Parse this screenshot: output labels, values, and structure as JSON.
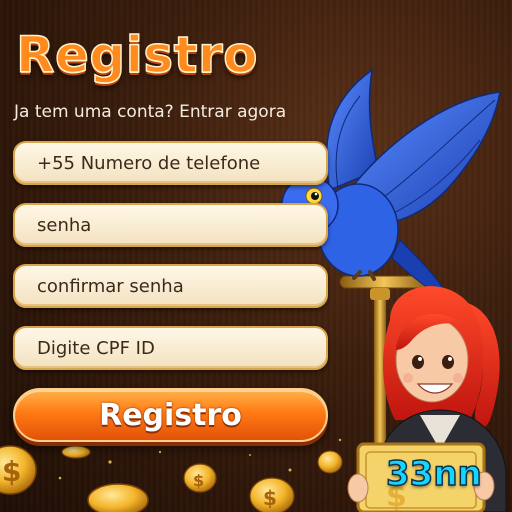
{
  "header": {
    "title": "Registro",
    "subtitle": "Ja tem uma conta? Entrar agora"
  },
  "form": {
    "phone_placeholder": "+55 Numero de telefone",
    "password_placeholder": "senha",
    "confirm_placeholder": "confirmar senha",
    "cpf_placeholder": "Digite CPF ID",
    "submit_label": "Registro"
  },
  "illustration": {
    "sign_text": "33nn",
    "parrot": "blue-macaw-icon",
    "character": "red-haired-girl-icon",
    "coins": "gold-coin-icon"
  },
  "colors": {
    "accent": "#ff7a14",
    "field_bg": "#fff7e6",
    "field_border": "#d9a54a",
    "sign_text": "#16d6ff"
  }
}
